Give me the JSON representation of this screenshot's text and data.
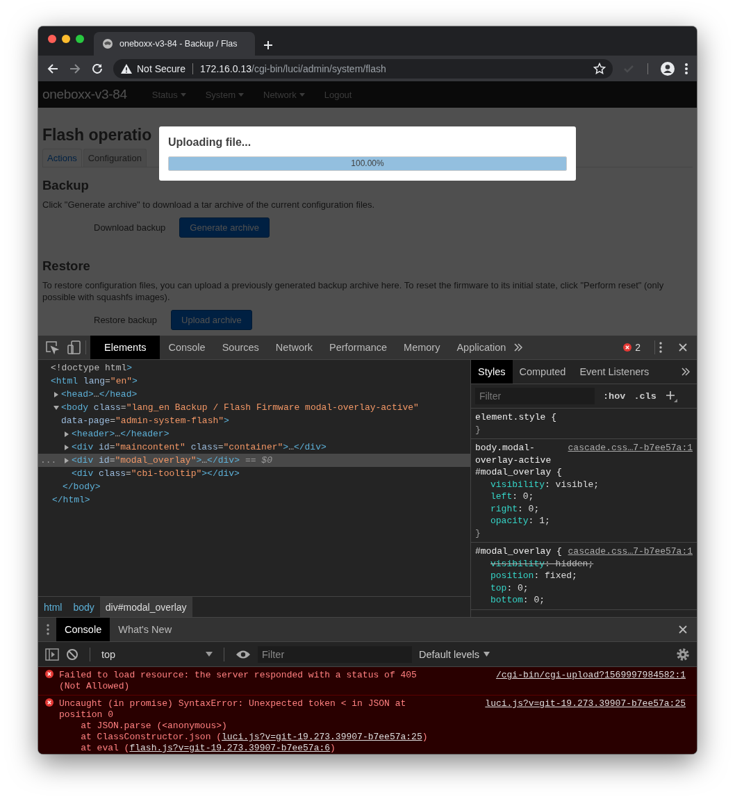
{
  "browser": {
    "tab": {
      "title": "oneboxx-v3-84 - Backup / Flas"
    },
    "address": {
      "security": "Not Secure",
      "host": "172.16.0.13",
      "path": "/cgi-bin/luci/admin/system/flash"
    }
  },
  "page": {
    "brand": "oneboxx-v3-84",
    "menu": [
      {
        "label": "Status",
        "dropdown": true
      },
      {
        "label": "System",
        "dropdown": true
      },
      {
        "label": "Network",
        "dropdown": true
      },
      {
        "label": "Logout",
        "dropdown": false
      }
    ],
    "title": "Flash operatio",
    "tabs": [
      {
        "label": "Actions",
        "selected": true
      },
      {
        "label": "Configuration",
        "selected": false
      }
    ],
    "sections": [
      {
        "heading": "Backup",
        "description": "Click \"Generate archive\" to download a tar archive of the current configuration files.",
        "field_label": "Download backup",
        "button": "Generate archive"
      },
      {
        "heading": "Restore",
        "description": "To restore configuration files, you can upload a previously generated backup archive here. To reset the firmware to its initial state, click \"Perform reset\" (only possible with squashfs images).",
        "field_label": "Restore backup",
        "button": "Upload archive"
      }
    ],
    "modal": {
      "title": "Uploading file...",
      "progress": {
        "level": 1,
        "text": "100.00%"
      }
    }
  },
  "devtools": {
    "tabs": [
      {
        "label": "Elements",
        "selected": true
      },
      {
        "label": "Console",
        "selected": false
      },
      {
        "label": "Sources",
        "selected": false
      },
      {
        "label": "Network",
        "selected": false
      },
      {
        "label": "Performance",
        "selected": false
      },
      {
        "label": "Memory",
        "selected": false
      },
      {
        "label": "Application",
        "selected": false
      }
    ],
    "error_count": "2",
    "dom_tree": [
      {
        "markup": "<!doctype html>",
        "selected": false
      },
      {
        "markup": "<html lang=\"en\">",
        "selected": false,
        "closing": "</html>",
        "children": [
          {
            "markup": "<head>…</head>",
            "selected": false,
            "expanded": false
          },
          {
            "markup": "<body class=\"lang_en Backup / Flash Firmware modal-overlay-active\" data-page=\"admin-system-flash\">",
            "selected": false,
            "expanded": true,
            "closing": "</body>",
            "children": [
              {
                "markup": "<header>…</header>",
                "selected": false,
                "expanded": false
              },
              {
                "markup": "<div id=\"maincontent\" class=\"container\">…</div>",
                "selected": false,
                "expanded": false
              },
              {
                "markup": "<div id=\"modal_overlay\">…</div>",
                "selected": true,
                "expanded": false,
                "gutter": "...",
                "suffix": "== $0"
              },
              {
                "markup": "<div class=\"cbi-tooltip\"></div>",
                "selected": false
              }
            ]
          }
        ]
      }
    ],
    "breadcrumbs": [
      {
        "label": "html",
        "selected": false
      },
      {
        "label": "body",
        "selected": false
      },
      {
        "label": "div#modal_overlay",
        "selected": true
      }
    ],
    "styles": {
      "tabs": [
        {
          "label": "Styles",
          "selected": true
        },
        {
          "label": "Computed",
          "selected": false
        },
        {
          "label": "Event Listeners",
          "selected": false
        }
      ],
      "filter_placeholder": "Filter",
      "hov": ":hov",
      "cls": ".cls",
      "rules": [
        {
          "selector": "element.style {",
          "close": "}"
        },
        {
          "selector": "body.modal-overlay-active #modal_overlay {",
          "source": "cascade.css…7-b7ee57a:1",
          "close": "}",
          "props": [
            {
              "text": "visibility: visible;",
              "overridden": false
            },
            {
              "text": "left: 0;",
              "overridden": false
            },
            {
              "text": "right: 0;",
              "overridden": false
            },
            {
              "text": "opacity: 1;",
              "overridden": false
            }
          ]
        },
        {
          "selector": "#modal_overlay {",
          "source": "cascade.css…7-b7ee57a:1",
          "props": [
            {
              "text": "visibility: hidden;",
              "overridden": true
            },
            {
              "text": "position: fixed;",
              "overridden": false
            },
            {
              "text": "top: 0;",
              "overridden": false
            },
            {
              "text": "bottom: 0;",
              "overridden": false
            }
          ]
        }
      ]
    },
    "console": {
      "drawer_tabs": [
        {
          "label": "Console",
          "selected": true
        },
        {
          "label": "What's New",
          "selected": false
        }
      ],
      "context": "top",
      "filter_placeholder": "Filter",
      "levels": "Default levels",
      "messages": [
        {
          "kind": "error",
          "text": "Failed to load resource: the server responded with a status of 405 (Not Allowed)",
          "source": "/cgi-bin/cgi-upload?1569997984582:1"
        },
        {
          "kind": "error",
          "text": "Uncaught (in promise) SyntaxError: Unexpected token < in JSON at position 0",
          "source": "luci.js?v=git-19.273.39907-b7ee57a:25",
          "stack": [
            {
              "text": "at JSON.parse (<anonymous>)"
            },
            {
              "text": "at ClassConstructor.json (",
              "link": "luci.js?v=git-19.273.39907-b7ee57a:25",
              "after": ")"
            },
            {
              "text": "at eval (",
              "link": "flash.js?v=git-19.273.39907-b7ee57a:6",
              "after": ")"
            }
          ]
        }
      ]
    }
  }
}
